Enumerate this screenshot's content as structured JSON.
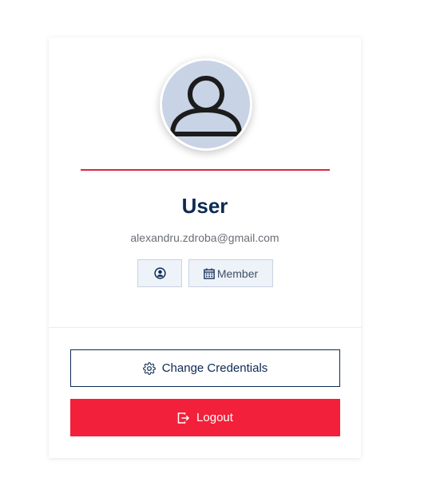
{
  "profile": {
    "name": "User",
    "email": "alexandru.zdroba@gmail.com",
    "badges": {
      "profile_icon": "user-circle-icon",
      "member_icon": "calendar-icon",
      "member_label": "Member"
    }
  },
  "actions": {
    "change_credentials_label": "Change Credentials",
    "change_credentials_icon": "gear-icon",
    "logout_label": "Logout",
    "logout_icon": "logout-icon"
  },
  "colors": {
    "accent_red": "#f2203a",
    "divider_red": "#dc2640",
    "navy": "#0d2a52",
    "avatar_bg": "#c8d3e6"
  }
}
